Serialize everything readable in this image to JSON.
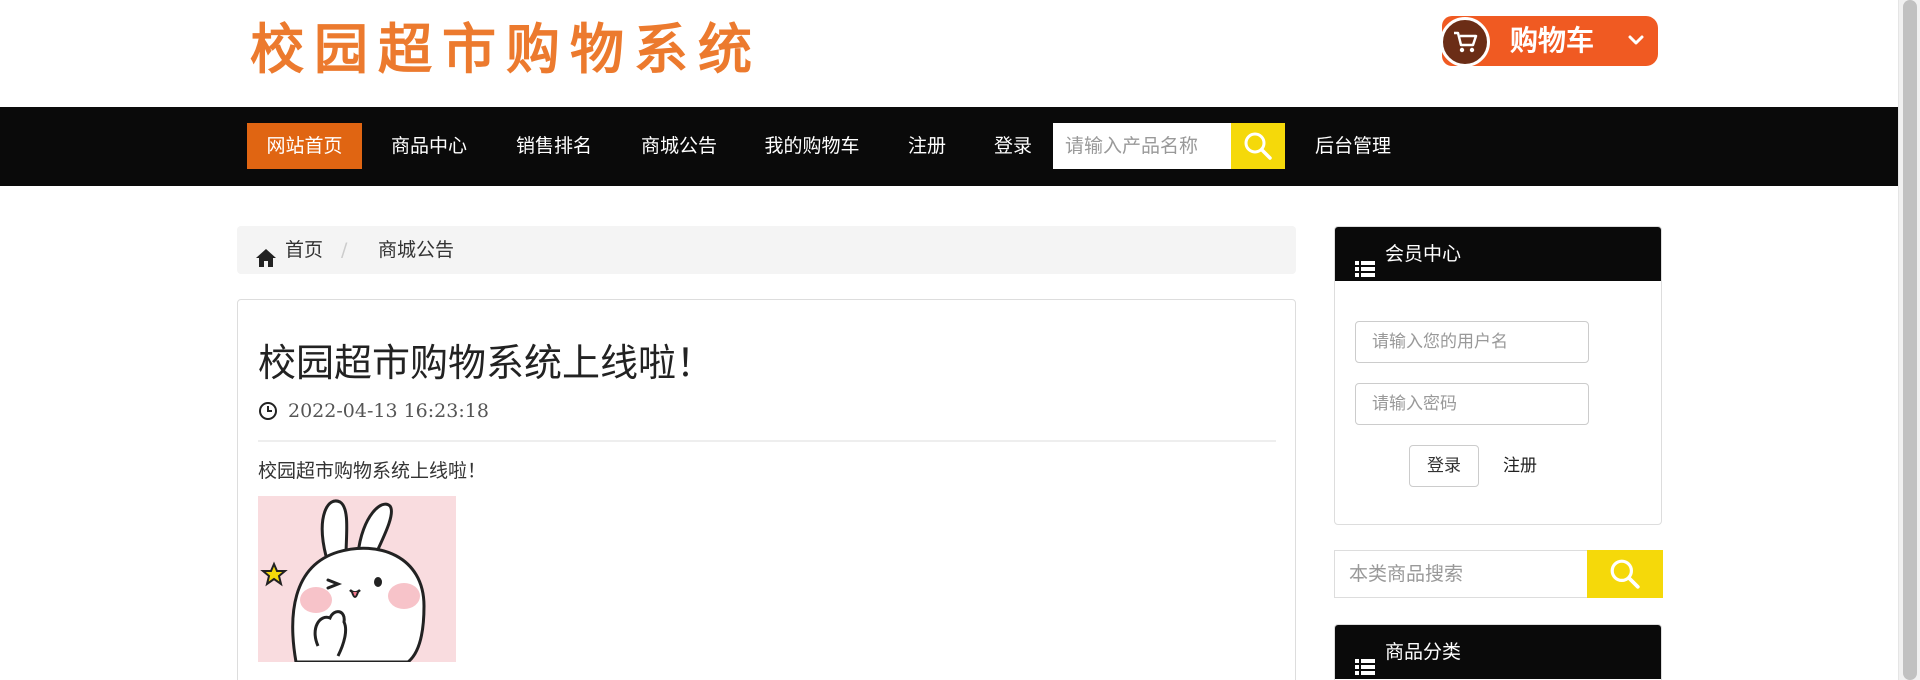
{
  "header": {
    "logo_text": "校园超市购物系统",
    "cart_label": "购物车",
    "cart_icon": "shopping-cart-icon",
    "cart_chevron_icon": "chevron-down-icon"
  },
  "nav": {
    "items": [
      {
        "label": "网站首页",
        "active": true
      },
      {
        "label": "商品中心"
      },
      {
        "label": "销售排名"
      },
      {
        "label": "商城公告"
      },
      {
        "label": "我的购物车"
      },
      {
        "label": "注册"
      },
      {
        "label": "登录"
      }
    ],
    "search_placeholder": "请输入产品名称",
    "search_icon": "search-icon",
    "admin_label": "后台管理"
  },
  "breadcrumb": {
    "home_icon": "home-icon",
    "home": "首页",
    "separator": "/",
    "current": "商城公告"
  },
  "article": {
    "title": "校园超市购物系统上线啦！",
    "date_icon": "clock-icon",
    "date": "2022-04-13 16:23:18",
    "body": "校园超市购物系统上线啦！",
    "image": "bunny-sticker"
  },
  "sidebar": {
    "member": {
      "title": "会员中心",
      "icon": "list-icon",
      "username_placeholder": "请输入您的用户名",
      "password_placeholder": "请输入密码",
      "login_label": "登录",
      "register_label": "注册"
    },
    "category_search": {
      "placeholder": "本类商品搜索"
    },
    "category": {
      "title": "商品分类",
      "icon": "list-icon"
    }
  },
  "colors": {
    "accent_orange": "#e06512",
    "nav_bg": "#0a0a0a",
    "search_yellow": "#f5d90a",
    "logo_orange": "#ec7a2e",
    "cart_red": "#f05a22"
  }
}
